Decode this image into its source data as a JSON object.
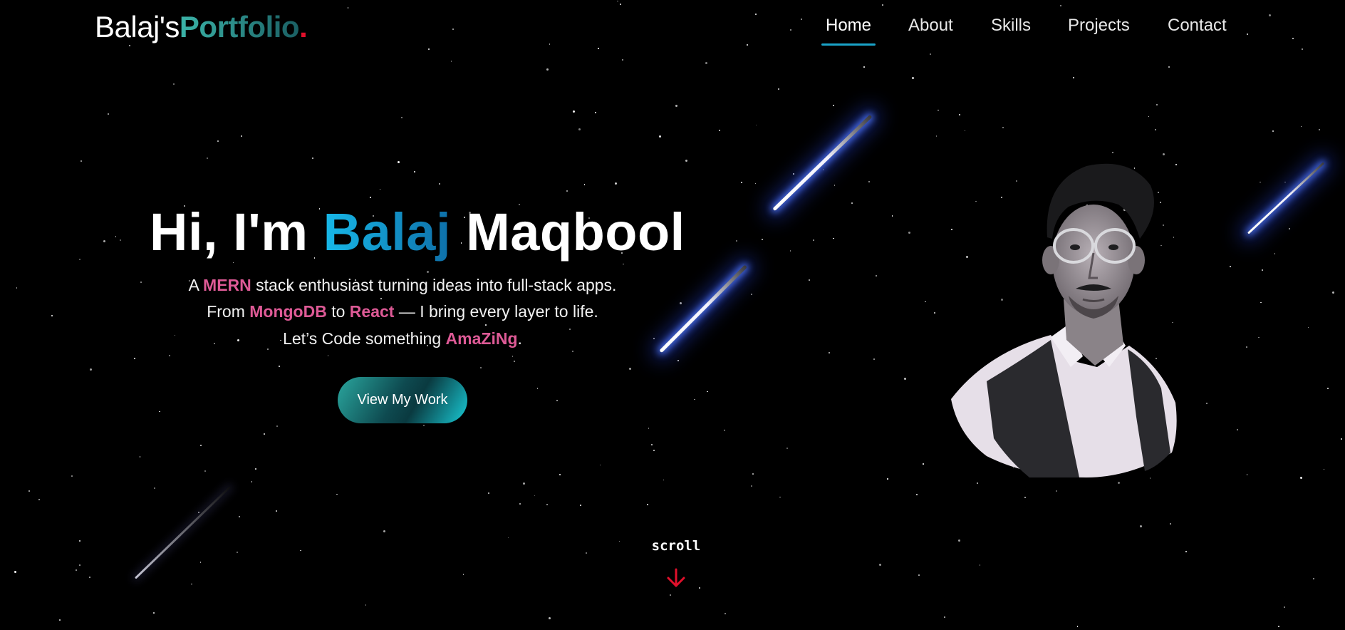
{
  "header": {
    "logo": {
      "part1": "Balaj's",
      "part2": "Portfolio",
      "dot": "."
    },
    "nav": [
      {
        "label": "Home",
        "active": true
      },
      {
        "label": "About",
        "active": false
      },
      {
        "label": "Skills",
        "active": false
      },
      {
        "label": "Projects",
        "active": false
      },
      {
        "label": "Contact",
        "active": false
      }
    ]
  },
  "hero": {
    "title_prefix": "Hi, I'm ",
    "title_highlight": "Balaj",
    "title_suffix": " Maqbool",
    "line1": {
      "a": "A ",
      "b": "MERN",
      "c": " stack enthusiast turning ideas into full-stack apps."
    },
    "line2": {
      "a": "From ",
      "b": "MongoDB",
      "c": " to ",
      "d": "React",
      "e": " — I bring every layer to life."
    },
    "line3": {
      "a": "Let’s Code something ",
      "b": "AmaZiNg",
      "c": "."
    },
    "cta_label": "View My Work"
  },
  "scroll": {
    "label": "scroll",
    "icon": "arrow-down-icon"
  },
  "portrait": {
    "icon": "profile-photo"
  },
  "colors": {
    "accent_blue": "#1aa3c8",
    "highlight_pink": "#de5a96",
    "logo_teal": "#3bb3a8",
    "logo_dot": "#e0102b",
    "scroll_arrow": "#e0102b",
    "background": "#000000"
  }
}
